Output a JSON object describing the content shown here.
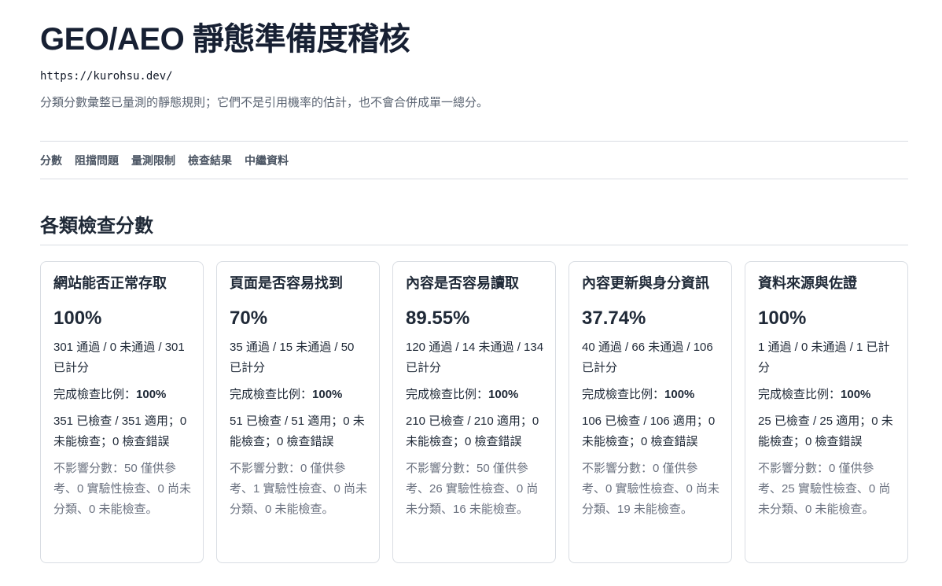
{
  "header": {
    "title": "GEO/AEO 靜態準備度稽核",
    "url": "https://kurohsu.dev/",
    "subtitle": "分類分數彙整已量測的靜態規則；它們不是引用機率的估計，也不會合併成單一總分。"
  },
  "nav": {
    "items": [
      {
        "label": "分數"
      },
      {
        "label": "阻擋問題"
      },
      {
        "label": "量測限制"
      },
      {
        "label": "檢查結果"
      },
      {
        "label": "中繼資料"
      }
    ]
  },
  "section": {
    "title": "各類檢查分數"
  },
  "cards": [
    {
      "title": "網站能否正常存取",
      "score": "100%",
      "counts": "301 通過 / 0 未通過 / 301 已計分",
      "completion_label": "完成檢查比例：",
      "completion_value": "100%",
      "checked": "351 已檢查 / 351 適用；0 未能檢查；0 檢查錯誤",
      "note": "不影響分數：50 僅供參考、0 實驗性檢查、0 尚未分類、0 未能檢查。"
    },
    {
      "title": "頁面是否容易找到",
      "score": "70%",
      "counts": "35 通過 / 15 未通過 / 50 已計分",
      "completion_label": "完成檢查比例：",
      "completion_value": "100%",
      "checked": "51 已檢查 / 51 適用；0 未能檢查；0 檢查錯誤",
      "note": "不影響分數：0 僅供參考、1 實驗性檢查、0 尚未分類、0 未能檢查。"
    },
    {
      "title": "內容是否容易讀取",
      "score": "89.55%",
      "counts": "120 通過 / 14 未通過 / 134 已計分",
      "completion_label": "完成檢查比例：",
      "completion_value": "100%",
      "checked": "210 已檢查 / 210 適用；0 未能檢查；0 檢查錯誤",
      "note": "不影響分數：50 僅供參考、26 實驗性檢查、0 尚未分類、16 未能檢查。"
    },
    {
      "title": "內容更新與身分資訊",
      "score": "37.74%",
      "counts": "40 通過 / 66 未通過 / 106 已計分",
      "completion_label": "完成檢查比例：",
      "completion_value": "100%",
      "checked": "106 已檢查 / 106 適用；0 未能檢查；0 檢查錯誤",
      "note": "不影響分數：0 僅供參考、0 實驗性檢查、0 尚未分類、19 未能檢查。"
    },
    {
      "title": "資料來源與佐證",
      "score": "100%",
      "counts": "1 通過 / 0 未通過 / 1 已計分",
      "completion_label": "完成檢查比例：",
      "completion_value": "100%",
      "checked": "25 已檢查 / 25 適用；0 未能檢查；0 檢查錯誤",
      "note": "不影響分數：0 僅供參考、25 實驗性檢查、0 尚未分類、0 未能檢查。"
    }
  ]
}
